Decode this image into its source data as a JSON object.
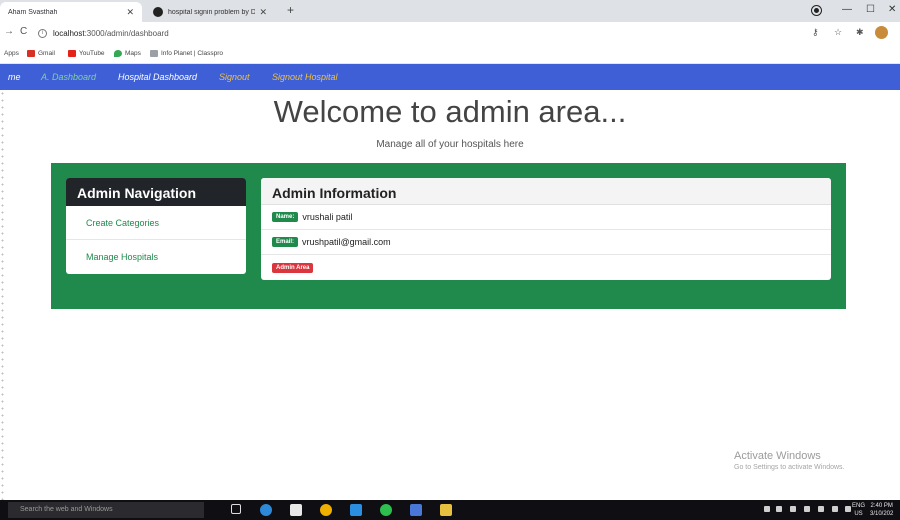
{
  "browser": {
    "tabs": [
      {
        "label": "Aham Svasthah",
        "active": true
      },
      {
        "label": "hospital signin problem by Dhiraj",
        "active": false
      }
    ],
    "new_tab": "+",
    "address": {
      "host": "localhost",
      "path": ":3000/admin/dashboard"
    },
    "bookmarks": [
      {
        "label": "Apps",
        "icon": "apps-grid-icon"
      },
      {
        "label": "Gmail",
        "icon": "gmail-icon"
      },
      {
        "label": "YouTube",
        "icon": "youtube-icon"
      },
      {
        "label": "Maps",
        "icon": "maps-pin-icon"
      },
      {
        "label": "Info Planet | Classpro",
        "icon": "info-planet-icon"
      }
    ]
  },
  "navbar": {
    "brand_fragment": "me",
    "links": [
      {
        "label": "A. Dashboard",
        "color": "#7fd0a0"
      },
      {
        "label": "Hospital Dashboard",
        "color": "#ffffff"
      },
      {
        "label": "Signout",
        "color": "#f0c040"
      },
      {
        "label": "Signout Hospital",
        "color": "#f0c040"
      }
    ]
  },
  "hero": {
    "title": "Welcome to admin area...",
    "subtitle": "Manage all of your hospitals here"
  },
  "admin_nav": {
    "title": "Admin Navigation",
    "items": [
      "Create Categories",
      "Manage Hospitals"
    ]
  },
  "admin_info": {
    "title": "Admin Information",
    "name_badge": "Name:",
    "name": "vrushali patil",
    "email_badge": "Email:",
    "email": "vrushpatil@gmail.com",
    "area_badge": "Admin Area"
  },
  "watermark": {
    "title": "Activate Windows",
    "subtitle": "Go to Settings to activate Windows."
  },
  "taskbar": {
    "search_placeholder": "Search the web and Windows",
    "lang": "ENG",
    "region": "US",
    "time": "2:40 PM",
    "date": "3/10/202"
  },
  "colors": {
    "navbar": "#3f5fd6",
    "panel_green": "#1f8a4c",
    "badge_green": "#1f8a4c",
    "badge_red": "#d9363e",
    "dark_header": "#212529"
  }
}
